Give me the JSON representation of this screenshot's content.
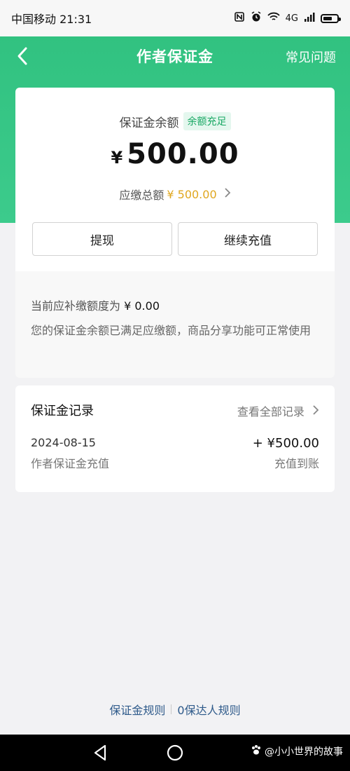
{
  "status_bar": {
    "carrier": "中国移动",
    "time": "21:31",
    "network": "4G"
  },
  "nav": {
    "title": "作者保证金",
    "faq": "常见问题"
  },
  "balance": {
    "label": "保证金余额",
    "badge": "余额充足",
    "currency": "¥",
    "amount": "500.00",
    "total_label": "应缴总额",
    "total_value": "¥ 500.00"
  },
  "actions": {
    "withdraw": "提现",
    "recharge": "继续充值"
  },
  "info": {
    "supplement_label": "当前应补缴额度为",
    "supplement_value": "¥ 0.00",
    "message": "您的保证金余额已满足应缴额，商品分享功能可正常使用"
  },
  "records": {
    "title": "保证金记录",
    "view_all": "查看全部记录",
    "items": [
      {
        "date": "2024-08-15",
        "type": "作者保证金充值",
        "amount": "+ ¥500.00",
        "status": "充值到账"
      }
    ]
  },
  "footer": {
    "link1": "保证金规则",
    "link2": "0保达人规则"
  },
  "watermark": "@小小世界的故事",
  "colors": {
    "brand_green": "#2fc07e",
    "badge_green": "#19a864",
    "amount_gold": "#e0a720",
    "link_blue": "#2e5a8a"
  }
}
